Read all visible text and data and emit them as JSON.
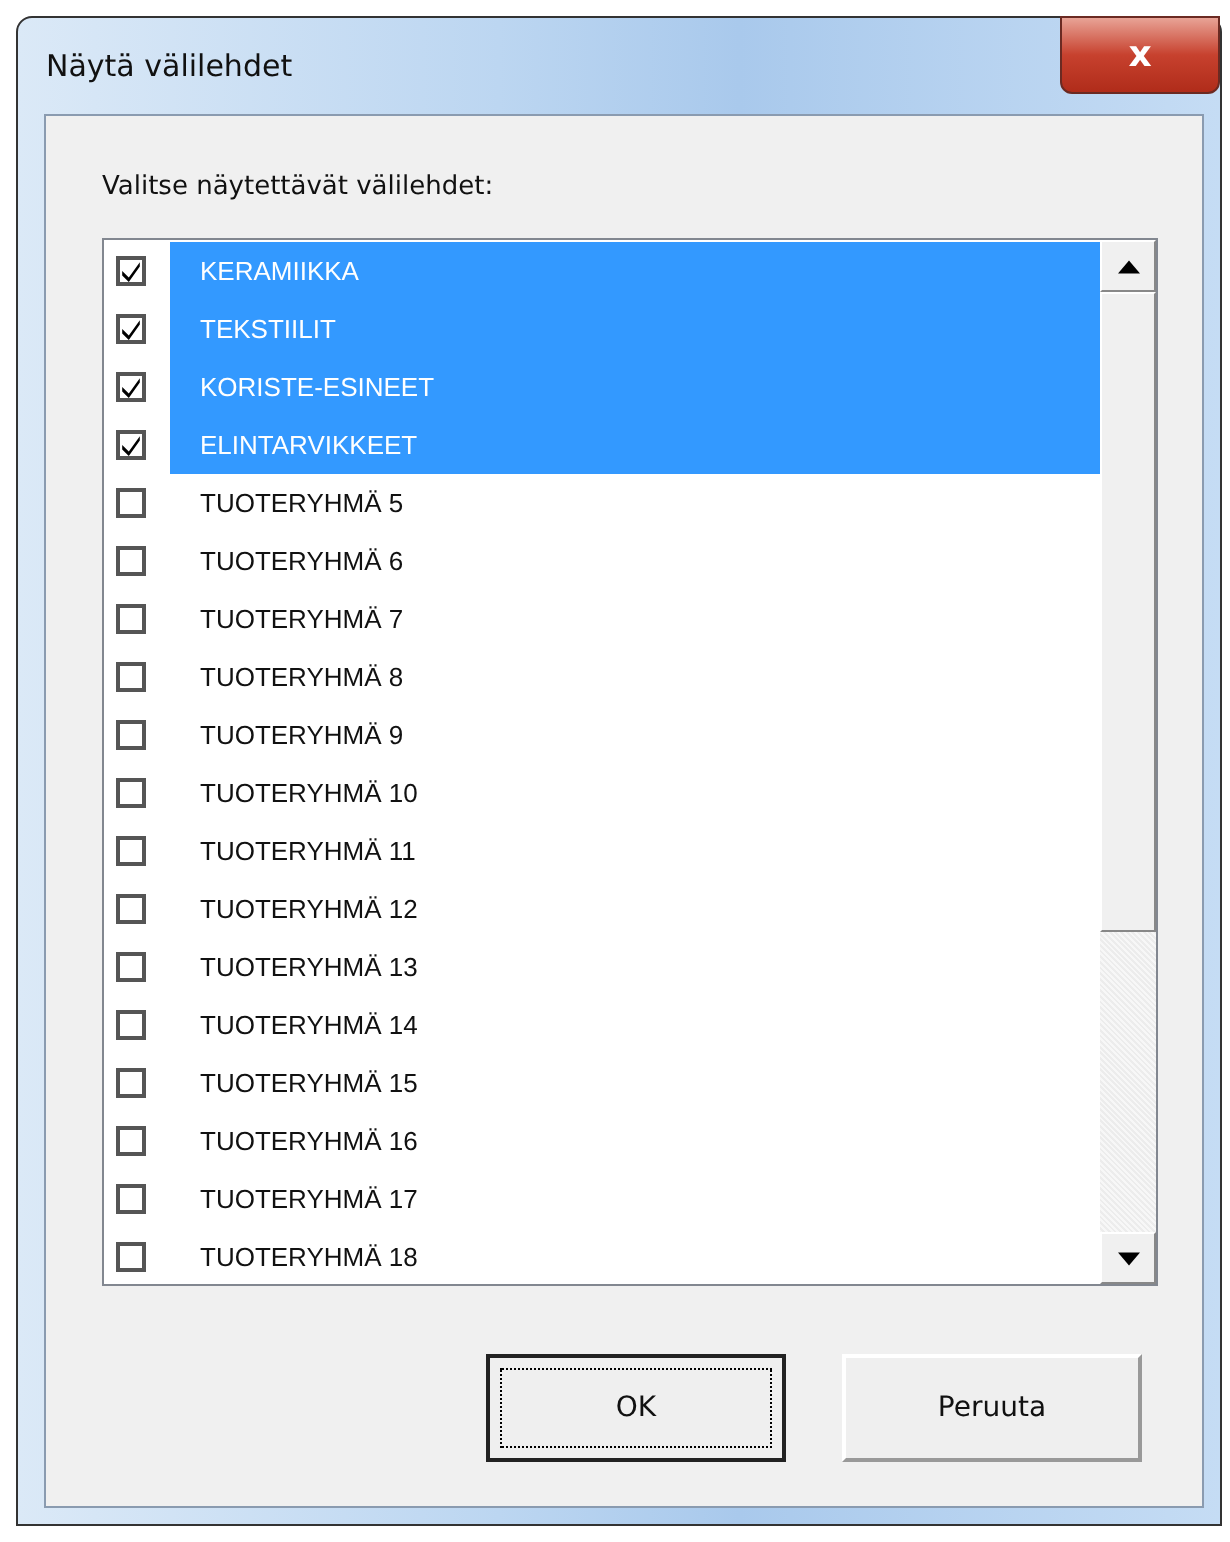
{
  "window": {
    "title": "Näytä välilehdet",
    "close_label": "x"
  },
  "prompt": "Valitse näytettävät välilehdet:",
  "items": [
    {
      "label": "KERAMIIKKA",
      "checked": true,
      "selected": true
    },
    {
      "label": "TEKSTIILIT",
      "checked": true,
      "selected": true
    },
    {
      "label": "KORISTE-ESINEET",
      "checked": true,
      "selected": true
    },
    {
      "label": "ELINTARVIKKEET",
      "checked": true,
      "selected": true
    },
    {
      "label": "TUOTERYHMÄ 5",
      "checked": false,
      "selected": false
    },
    {
      "label": "TUOTERYHMÄ 6",
      "checked": false,
      "selected": false
    },
    {
      "label": "TUOTERYHMÄ 7",
      "checked": false,
      "selected": false
    },
    {
      "label": "TUOTERYHMÄ 8",
      "checked": false,
      "selected": false
    },
    {
      "label": "TUOTERYHMÄ 9",
      "checked": false,
      "selected": false
    },
    {
      "label": "TUOTERYHMÄ 10",
      "checked": false,
      "selected": false
    },
    {
      "label": "TUOTERYHMÄ 11",
      "checked": false,
      "selected": false
    },
    {
      "label": "TUOTERYHMÄ 12",
      "checked": false,
      "selected": false
    },
    {
      "label": "TUOTERYHMÄ 13",
      "checked": false,
      "selected": false
    },
    {
      "label": "TUOTERYHMÄ 14",
      "checked": false,
      "selected": false
    },
    {
      "label": "TUOTERYHMÄ 15",
      "checked": false,
      "selected": false
    },
    {
      "label": "TUOTERYHMÄ 16",
      "checked": false,
      "selected": false
    },
    {
      "label": "TUOTERYHMÄ 17",
      "checked": false,
      "selected": false
    },
    {
      "label": "TUOTERYHMÄ 18",
      "checked": false,
      "selected": false
    }
  ],
  "buttons": [
    {
      "label": "OK",
      "default": true
    },
    {
      "label": "Peruuta",
      "default": false
    }
  ]
}
